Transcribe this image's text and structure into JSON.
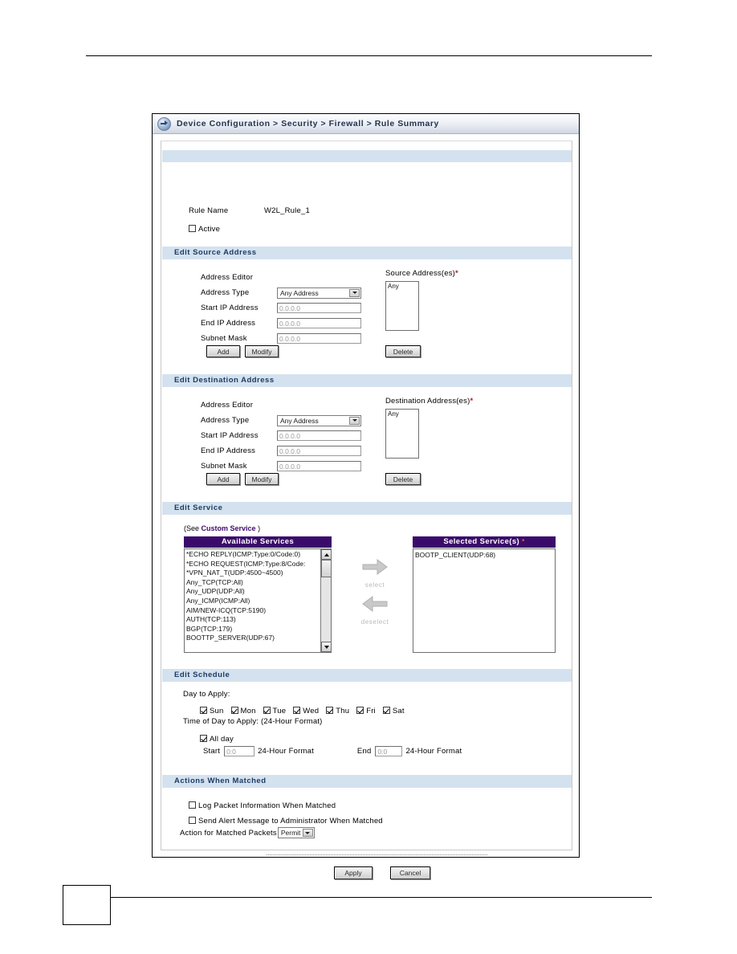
{
  "window": {
    "icon": "circle-arrow-icon",
    "breadcrumb": "Device Configuration > Security > Firewall > Rule Summary"
  },
  "rule": {
    "name_label": "Rule Name",
    "name_value": "W2L_Rule_1",
    "active_label": "Active",
    "active_checked": false
  },
  "source": {
    "section_title": "Edit Source Address",
    "editor_label": "Address Editor",
    "type_label": "Address Type",
    "type_value": "Any Address",
    "start_label": "Start IP Address",
    "start_value": "0.0.0.0",
    "end_label": "End IP Address",
    "end_value": "0.0.0.0",
    "mask_label": "Subnet Mask",
    "mask_value": "0.0.0.0",
    "add_label": "Add",
    "modify_label": "Modify",
    "list_label": "Source Address(es)",
    "list_required": "*",
    "list_items": [
      "Any"
    ],
    "delete_label": "Delete"
  },
  "destination": {
    "section_title": "Edit Destination Address",
    "editor_label": "Address Editor",
    "type_label": "Address Type",
    "type_value": "Any Address",
    "start_label": "Start IP Address",
    "start_value": "0.0.0.0",
    "end_label": "End IP Address",
    "end_value": "0.0.0.0",
    "mask_label": "Subnet Mask",
    "mask_value": "0.0.0.0",
    "add_label": "Add",
    "modify_label": "Modify",
    "list_label": "Destination Address(es)",
    "list_required": "*",
    "list_items": [
      "Any"
    ],
    "delete_label": "Delete"
  },
  "service": {
    "section_title": "Edit Service",
    "custom_link_prefix": "(See",
    "custom_link": "Custom Service",
    "custom_link_suffix": ")",
    "available_header": "Available Services",
    "selected_header": "Selected Service(s)",
    "selected_required": "*",
    "available_items": [
      "*ECHO REPLY(ICMP:Type:0/Code:0)",
      "*ECHO REQUEST(ICMP:Type:8/Code:",
      "*VPN_NAT_T(UDP:4500~4500)",
      "Any_TCP(TCP:All)",
      "Any_UDP(UDP:All)",
      "Any_ICMP(ICMP:All)",
      "AIM/NEW-ICQ(TCP:5190)",
      "AUTH(TCP:113)",
      "BGP(TCP:179)",
      "BOOTTP_SERVER(UDP:67)"
    ],
    "selected_items": [
      "BOOTP_CLIENT(UDP:68)"
    ],
    "select_label": "select",
    "deselect_label": "deselect"
  },
  "schedule": {
    "section_title": "Edit Schedule",
    "day_label": "Day to Apply:",
    "days": [
      {
        "label": "Sun",
        "checked": true
      },
      {
        "label": "Mon",
        "checked": true
      },
      {
        "label": "Tue",
        "checked": true
      },
      {
        "label": "Wed",
        "checked": true
      },
      {
        "label": "Thu",
        "checked": true
      },
      {
        "label": "Fri",
        "checked": true
      },
      {
        "label": "Sat",
        "checked": true
      }
    ],
    "time_label": "Time of Day to Apply: (24-Hour Format)",
    "allday_label": "All day",
    "allday_checked": true,
    "start_label": "Start",
    "start_value": "0:0",
    "start_hint": "24-Hour Format",
    "end_label": "End",
    "end_value": "0:0",
    "end_hint": "24-Hour Format"
  },
  "actions": {
    "section_title": "Actions When Matched",
    "log_label": "Log Packet Information When Matched",
    "log_checked": false,
    "alert_label": "Send Alert Message to Administrator When Matched",
    "alert_checked": false,
    "action_label": "Action for Matched Packets",
    "action_value": "Permit",
    "apply_label": "Apply",
    "cancel_label": "Cancel"
  },
  "colors": {
    "section_header_bg": "#d4e2ef",
    "section_header_text": "#1d3b63",
    "list_header_bg": "#3b0b6b",
    "required_star": "#b11c1c",
    "link": "#3b0b6b"
  }
}
